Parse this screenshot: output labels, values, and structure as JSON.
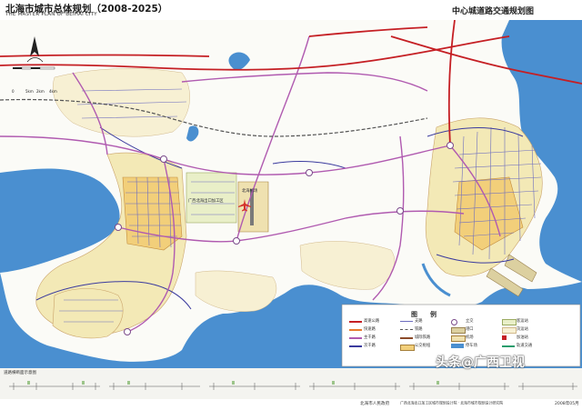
{
  "header": {
    "title_cn": "北海市城市总体规划（2008-2025）",
    "title_en": "THE MASTER PLAN OF BEIHAI CITY",
    "sheet_title": "中心城道路交通规划图"
  },
  "scale_bar": {
    "labels": [
      "0",
      "5km",
      "2km",
      "4km"
    ]
  },
  "map_labels": {
    "airport": "北海机场",
    "industrial_park": "广西北海出口加工区"
  },
  "legend": {
    "title": "图　　例",
    "items": [
      "高速公路",
      "快速路",
      "主干路",
      "次干路",
      "支路",
      "铁路",
      "城际铁路",
      "公交枢纽",
      "立交",
      "港口",
      "机场",
      "停车场",
      "客运站",
      "货运站",
      "加油站",
      "轨道交通"
    ]
  },
  "bottom": {
    "section_label": "道路横断面示意图"
  },
  "footer": {
    "left": "北海市人民政府",
    "center": "广西北海出口加工区城市规划设计院 · 北海市城市规划设计研究院",
    "right": "2008年05月"
  },
  "watermark": {
    "text": "头条@广西卫视"
  },
  "colors": {
    "sea": "#4a8fd0",
    "land": "#fbfbf7",
    "urban_zone": "#f3e9b6",
    "core_zone": "#f2cf7a",
    "highway": "#c51f24",
    "primary_road": "#b05ab0",
    "secondary_road": "#3b3b9e",
    "rail": "#555555"
  }
}
